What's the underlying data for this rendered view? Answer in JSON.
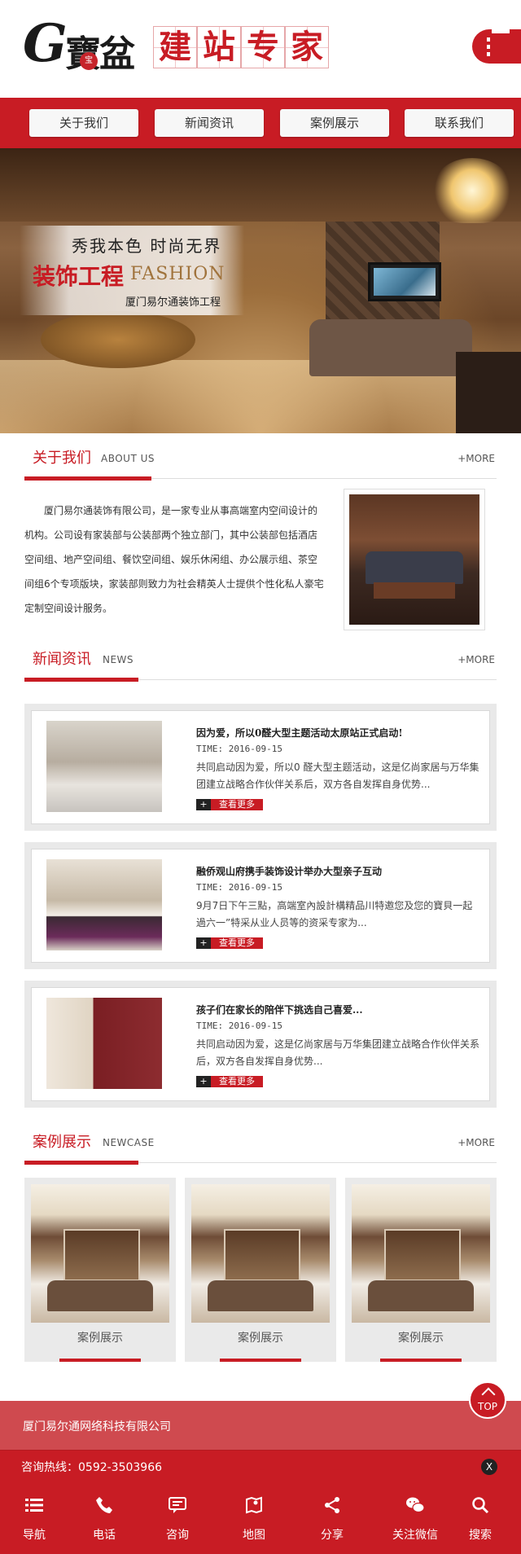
{
  "header": {
    "logo_letter": "G",
    "logo_script": "寶盆",
    "logo_seal": "宝",
    "title_chars": [
      "建",
      "站",
      "专",
      "家"
    ]
  },
  "nav": [
    "关于我们",
    "新闻资讯",
    "案例展示",
    "联系我们"
  ],
  "banner": {
    "line1": "秀我本色 时尚无界",
    "line2_cn": "装饰工程",
    "line2_en": "FASHION",
    "line3": "厦门易尔通装饰工程"
  },
  "about": {
    "title_cn": "关于我们",
    "title_en": "ABOUT US",
    "more": "+MORE",
    "text": "厦门易尔通装饰有限公司，是一家专业从事高端室内空间设计的机构。公司设有家装部与公装部两个独立部门，其中公装部包括酒店空间组、地产空间组、餐饮空间组、娱乐休闲组、办公展示组、茶空间组6个专项版块，家装部则致力为社会精英人士提供个性化私人豪宅定制空间设计服务。"
  },
  "news": {
    "title_cn": "新闻资讯",
    "title_en": "NEWS",
    "more": "+MORE",
    "more_label": "查看更多",
    "items": [
      {
        "title": "因为爱，所以0醛大型主题活动太原站正式启动!",
        "time": "TIME: 2016-09-15",
        "desc": "共同启动因为爱，所以0 醛大型主题活动，这是亿尚家居与万华集团建立战略合作伙伴关系后，双方各自发挥自身优势..."
      },
      {
        "title": "融侨观山府携手装饰设计举办大型亲子互动",
        "time": "TIME: 2016-09-15",
        "desc": "9月7日下午三點，高端室內設計構精品川特邀您及您的寶貝一起過六一”特采从业人员等的资采专家为..."
      },
      {
        "title": "孩子们在家长的陪伴下挑选自己喜爱...",
        "time": "TIME: 2016-09-15",
        "desc": "共同启动因为爱，这是亿尚家居与万华集团建立战略合作伙伴关系后，双方各自发挥自身优势..."
      }
    ]
  },
  "cases": {
    "title_cn": "案例展示",
    "title_en": "NEWCASE",
    "more": "+MORE",
    "items": [
      "案例展示",
      "案例展示",
      "案例展示"
    ]
  },
  "footer": {
    "company": "厦门易尔通网络科技有限公司",
    "hotline": "咨询热线：0592-3503966",
    "close": "X",
    "top": "TOP"
  },
  "bottom_bar": [
    {
      "label": "导航",
      "icon": "menu-icon"
    },
    {
      "label": "电话",
      "icon": "phone-icon"
    },
    {
      "label": "咨询",
      "icon": "chat-icon"
    },
    {
      "label": "地图",
      "icon": "map-icon"
    },
    {
      "label": "分享",
      "icon": "share-icon"
    },
    {
      "label": "关注微信",
      "icon": "wechat-icon"
    },
    {
      "label": "搜索",
      "icon": "search-icon"
    }
  ],
  "colors": {
    "brand_red": "#c81c24",
    "footer_light_red": "#cf4a4f"
  }
}
